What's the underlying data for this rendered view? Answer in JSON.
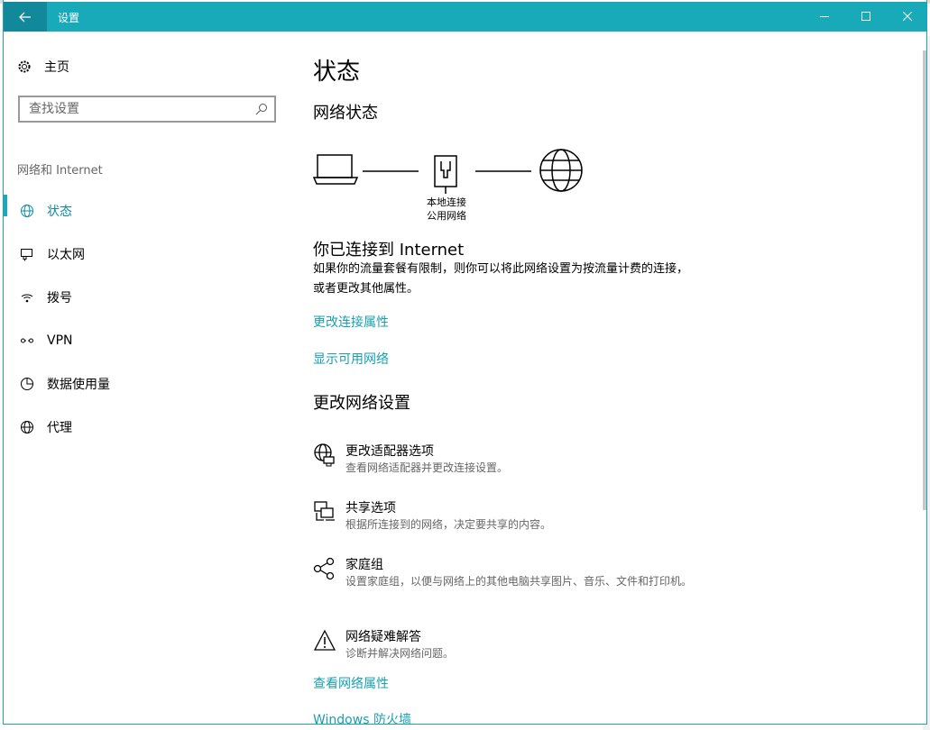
{
  "window": {
    "title": "设置"
  },
  "sidebar": {
    "home_label": "主页",
    "search_placeholder": "查找设置",
    "section_label": "网络和 Internet",
    "items": [
      {
        "label": "状态",
        "icon": "globe-status-icon",
        "active": true
      },
      {
        "label": "以太网",
        "icon": "ethernet-icon",
        "active": false
      },
      {
        "label": "拨号",
        "icon": "dialup-icon",
        "active": false
      },
      {
        "label": "VPN",
        "icon": "vpn-icon",
        "active": false
      },
      {
        "label": "数据使用量",
        "icon": "data-usage-icon",
        "active": false
      },
      {
        "label": "代理",
        "icon": "proxy-globe-icon",
        "active": false
      }
    ]
  },
  "main": {
    "title": "状态",
    "network_status_heading": "网络状态",
    "diagram": {
      "adapter_name": "本地连接",
      "network_type": "公用网络"
    },
    "connected_title": "你已连接到 Internet",
    "connected_desc": "如果你的流量套餐有限制，则你可以将此网络设置为按流量计费的连接，或者更改其他属性。",
    "link_change_props": "更改连接属性",
    "link_show_networks": "显示可用网络",
    "change_settings_heading": "更改网络设置",
    "options": [
      {
        "title": "更改适配器选项",
        "desc": "查看网络适配器并更改连接设置。",
        "icon": "adapter-icon"
      },
      {
        "title": "共享选项",
        "desc": "根据所连接到的网络，决定要共享的内容。",
        "icon": "sharing-icon"
      },
      {
        "title": "家庭组",
        "desc": "设置家庭组，以便与网络上的其他电脑共享图片、音乐、文件和打印机。",
        "icon": "homegroup-icon"
      },
      {
        "title": "网络疑难解答",
        "desc": "诊断并解决网络问题。",
        "icon": "warning-icon"
      }
    ],
    "link_view_props": "查看网络属性",
    "link_firewall": "Windows 防火墙"
  },
  "colors": {
    "accent": "#18aab9",
    "link": "#18a0b0"
  }
}
